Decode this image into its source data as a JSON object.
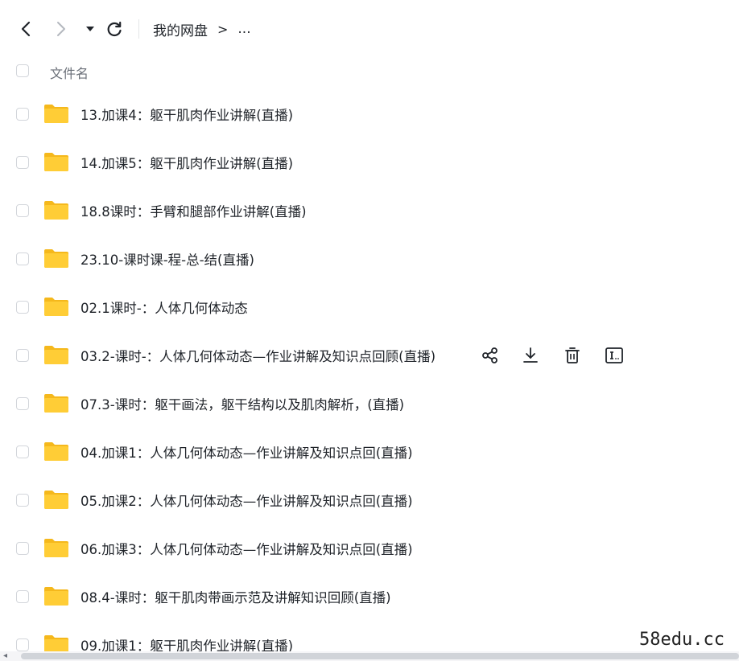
{
  "toolbar": {
    "back_icon": "chevron-left-icon",
    "forward_icon": "chevron-right-icon",
    "history_icon": "caret-down-icon",
    "refresh_icon": "refresh-icon"
  },
  "breadcrumb": {
    "root": "我的网盘",
    "separator": ">",
    "more": "..."
  },
  "header": {
    "name_column": "文件名"
  },
  "files": [
    {
      "name": "13.加课4：躯干肌肉作业讲解(直播)"
    },
    {
      "name": "14.加课5：躯干肌肉作业讲解(直播)"
    },
    {
      "name": "18.8课时：手臂和腿部作业讲解(直播)"
    },
    {
      "name": "23.10-课时课-程-总-结(直播)"
    },
    {
      "name": "02.1课时-：人体几何体动态"
    },
    {
      "name": "03.2-课时-：人体几何体动态—作业讲解及知识点回顾(直播)"
    },
    {
      "name": "07.3-课时：躯干画法，躯干结构以及肌肉解析，(直播)"
    },
    {
      "name": "04.加课1：人体几何体动态—作业讲解及知识点回(直播)"
    },
    {
      "name": "05.加课2：人体几何体动态—作业讲解及知识点回(直播)"
    },
    {
      "name": "06.加课3：人体几何体动态—作业讲解及知识点回(直播)"
    },
    {
      "name": "08.4-课时：躯干肌肉带画示范及讲解知识回顾(直播)"
    },
    {
      "name": "09.加课1：躯干肌肉作业讲解(直播)"
    }
  ],
  "row_actions": {
    "share_icon": "share-icon",
    "download_icon": "download-icon",
    "delete_icon": "trash-icon",
    "rename_icon": "rename-icon"
  },
  "colors": {
    "folder": "#FFCD36",
    "folder_tab": "#F5B81C",
    "text": "#1f2329",
    "muted": "#6b7079"
  },
  "watermark": "58edu.cc"
}
